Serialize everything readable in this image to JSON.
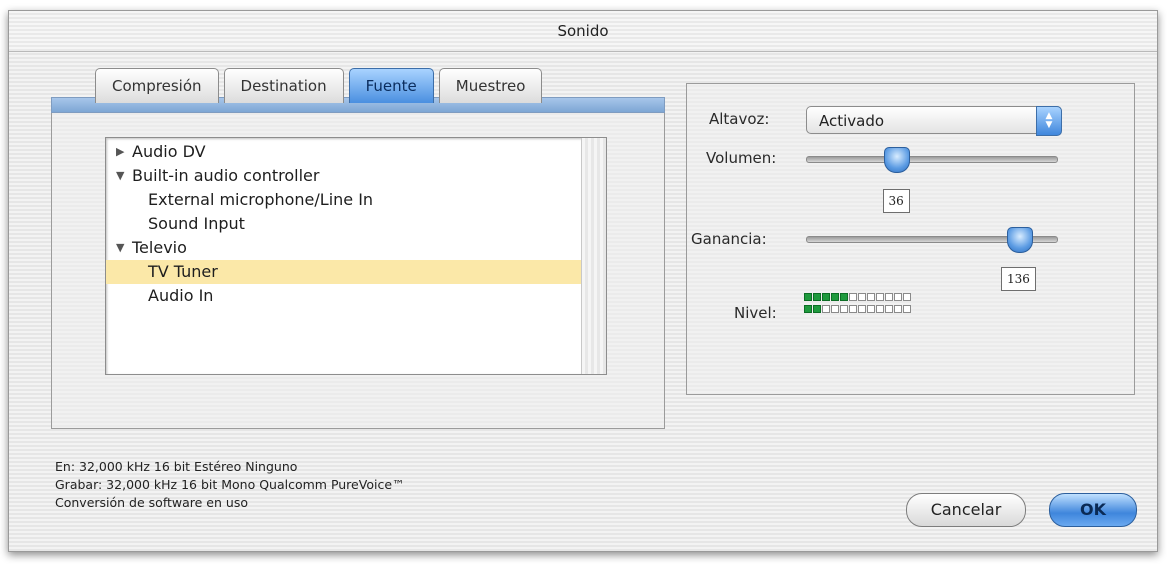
{
  "window": {
    "title": "Sonido"
  },
  "tabs": [
    {
      "label": "Compresión"
    },
    {
      "label": "Destination"
    },
    {
      "label": "Fuente",
      "active": true
    },
    {
      "label": "Muestreo"
    }
  ],
  "source_list": {
    "items": [
      {
        "label": "Audio DV",
        "expander": "▶"
      },
      {
        "label": "Built-in audio controller",
        "expander": "▼"
      },
      {
        "label": "External microphone/Line In"
      },
      {
        "label": "Sound Input"
      },
      {
        "label": "Televio",
        "expander": "▼"
      },
      {
        "label": "TV Tuner",
        "selected": true
      },
      {
        "label": "Audio In"
      }
    ]
  },
  "speaker": {
    "label": "Altavoz:",
    "value": "Activado"
  },
  "volume": {
    "label": "Volumen:",
    "value": "36",
    "level": 0.36
  },
  "gain": {
    "label": "Ganancia:",
    "value": "136",
    "level": 0.85
  },
  "level_meter": {
    "label": "Nivel:",
    "channels": [
      5,
      2
    ],
    "segments": 12
  },
  "info_lines": {
    "input": "En: 32,000 kHz 16 bit Estéreo Ninguno",
    "record": "Grabar: 32,000 kHz 16 bit Mono Qualcomm PureVoice™",
    "conversion": "Conversión de software en uso"
  },
  "buttons": {
    "cancel": "Cancelar",
    "ok": "OK"
  },
  "colors": {
    "accent": "#4a8fe0",
    "selection": "#fbe8a8",
    "meter_on": "#1e9a3d"
  }
}
